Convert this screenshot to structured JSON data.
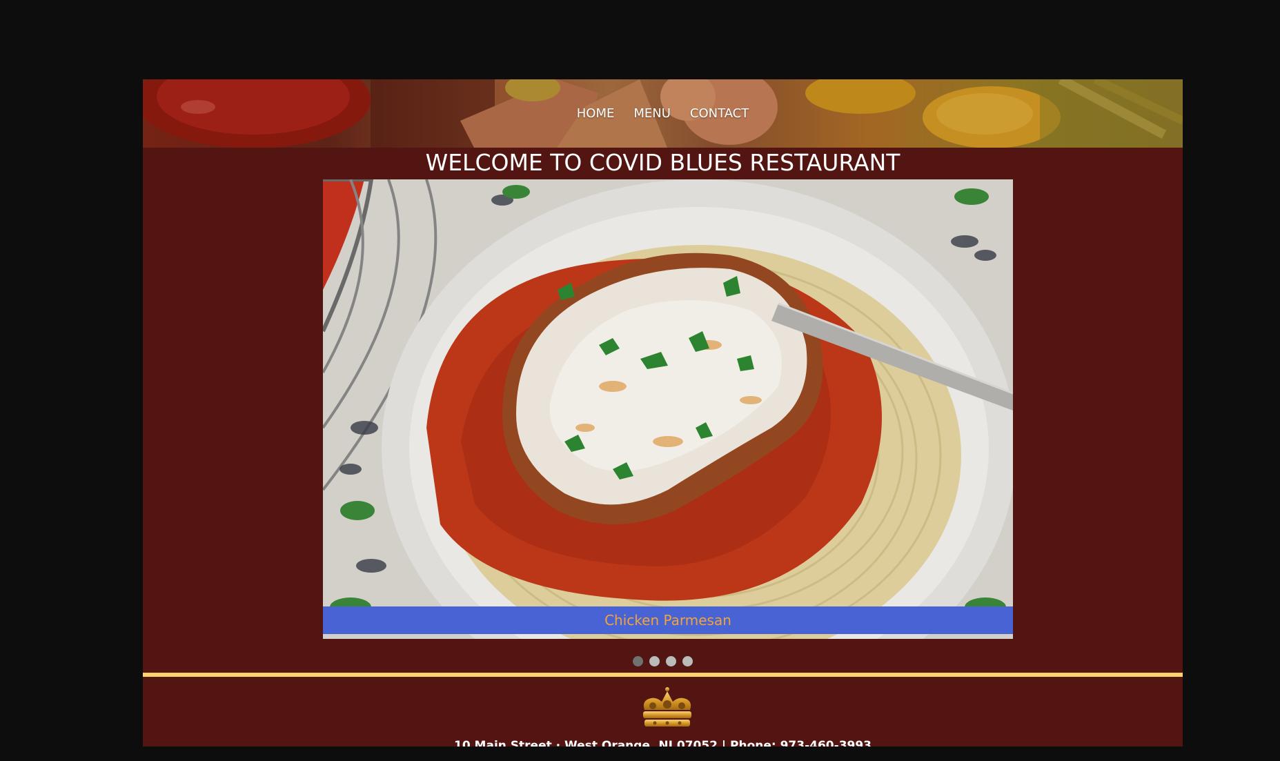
{
  "nav": {
    "items": [
      {
        "label": "HOME"
      },
      {
        "label": "MENU"
      },
      {
        "label": "CONTACT"
      }
    ]
  },
  "main": {
    "title": "WELCOME TO COVID BLUES RESTAURANT"
  },
  "slideshow": {
    "current_caption": "Chicken Parmesan",
    "slide_count": 4,
    "active_index": 0
  },
  "footer": {
    "address": "10 Main Street · West Orange, NJ 07052 | Phone: 973-460-3993"
  },
  "colors": {
    "page_background": "#0d0d0d",
    "content_background": "#521512",
    "caption_background": "#4863d4",
    "caption_text": "#f2a33a",
    "divider": "#ffd36b",
    "dot_inactive": "#bbbbbb",
    "dot_active": "#717171"
  },
  "icons": [
    "crown-icon"
  ]
}
